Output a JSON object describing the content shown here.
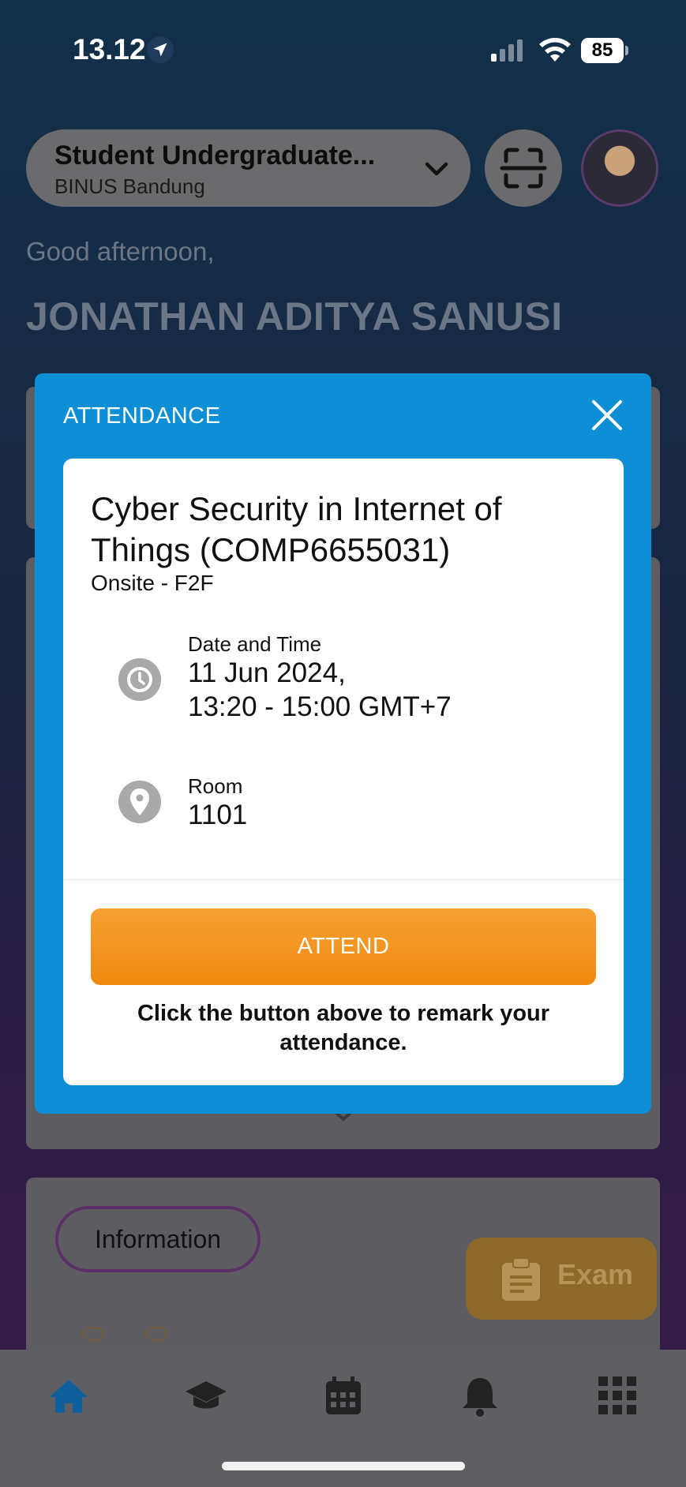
{
  "status_bar": {
    "time": "13.12",
    "battery": "85"
  },
  "header": {
    "role_title": "Student Undergraduate...",
    "role_subtitle": "BINUS Bandung"
  },
  "greeting": "Good afternoon,",
  "user_name": "JONATHAN ADITYA SANUSI",
  "modal": {
    "title": "ATTENDANCE",
    "course_title": "Cyber Security in Internet of Things (COMP6655031)",
    "course_mode": "Onsite - F2F",
    "datetime_label": "Date and Time",
    "date": "11 Jun 2024,",
    "time": "13:20 - 15:00 GMT+7",
    "room_label": "Room",
    "room": "1101",
    "attend_label": "ATTEND",
    "hint": "Click the button above to remark your attendance."
  },
  "background": {
    "information_label": "Information",
    "exam_label": "Exam"
  },
  "tabs": [
    "home-icon",
    "graduation-cap-icon",
    "calendar-icon",
    "bell-icon",
    "grid-icon"
  ],
  "colors": {
    "modal_blue": "#0d8ed5",
    "attend_orange": "#ef8a10",
    "tab_active": "#0e6fb8"
  }
}
